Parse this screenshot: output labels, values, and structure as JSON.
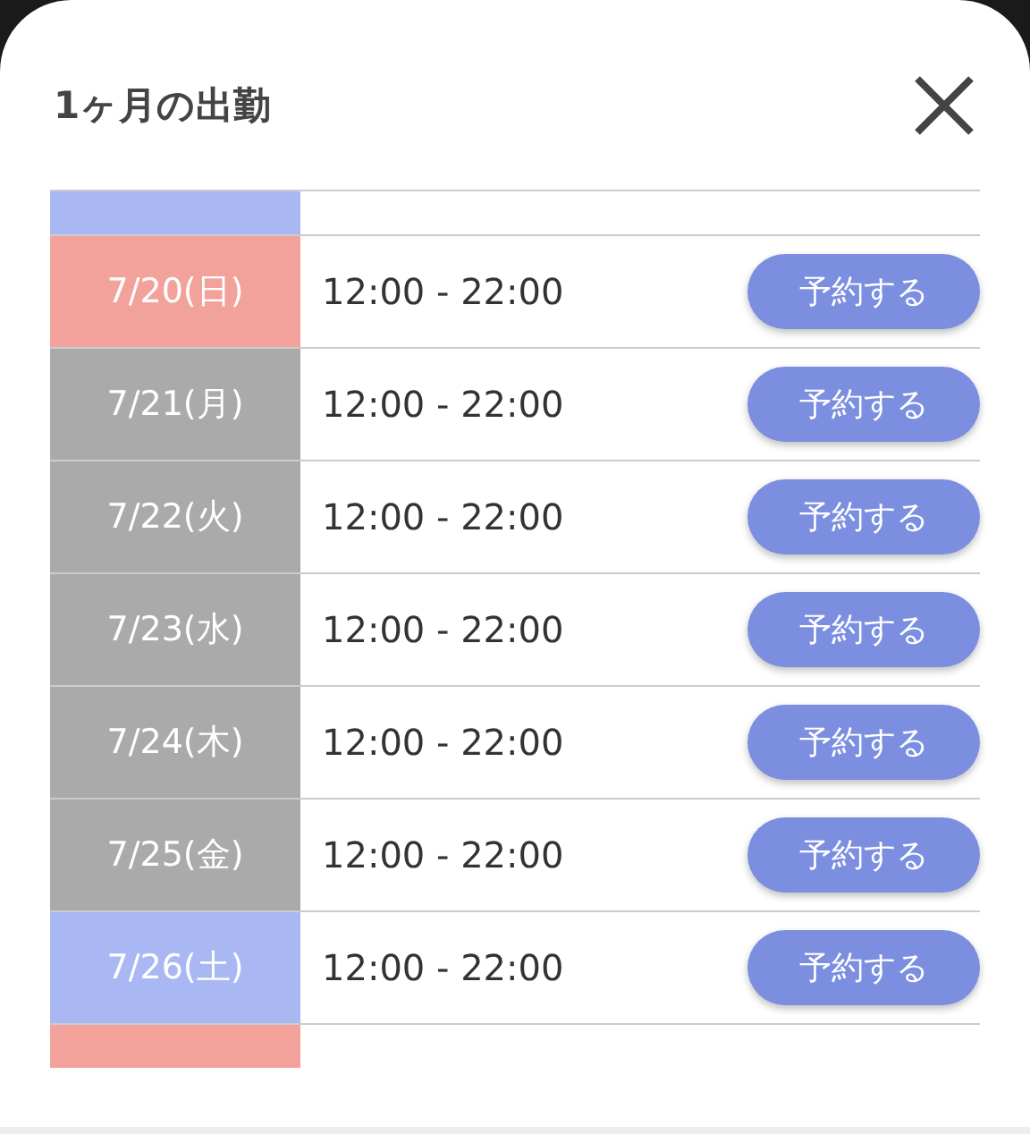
{
  "sheet": {
    "title": "1ヶ月の出勤"
  },
  "rows": [
    {
      "kind": "clipped",
      "color": "#a9b8f3"
    },
    {
      "kind": "full",
      "color": "#f2a29a",
      "date": "7/20(日)",
      "time": "12:00 - 22:00",
      "button": "予約する"
    },
    {
      "kind": "full",
      "color": "#aaaaaa",
      "date": "7/21(月)",
      "time": "12:00 - 22:00",
      "button": "予約する"
    },
    {
      "kind": "full",
      "color": "#aaaaaa",
      "date": "7/22(火)",
      "time": "12:00 - 22:00",
      "button": "予約する"
    },
    {
      "kind": "full",
      "color": "#aaaaaa",
      "date": "7/23(水)",
      "time": "12:00 - 22:00",
      "button": "予約する"
    },
    {
      "kind": "full",
      "color": "#aaaaaa",
      "date": "7/24(木)",
      "time": "12:00 - 22:00",
      "button": "予約する"
    },
    {
      "kind": "full",
      "color": "#aaaaaa",
      "date": "7/25(金)",
      "time": "12:00 - 22:00",
      "button": "予約する"
    },
    {
      "kind": "full",
      "color": "#a9b8f3",
      "date": "7/26(土)",
      "time": "12:00 - 22:00",
      "button": "予約する"
    },
    {
      "kind": "clipped",
      "color": "#f2a29a"
    }
  ]
}
